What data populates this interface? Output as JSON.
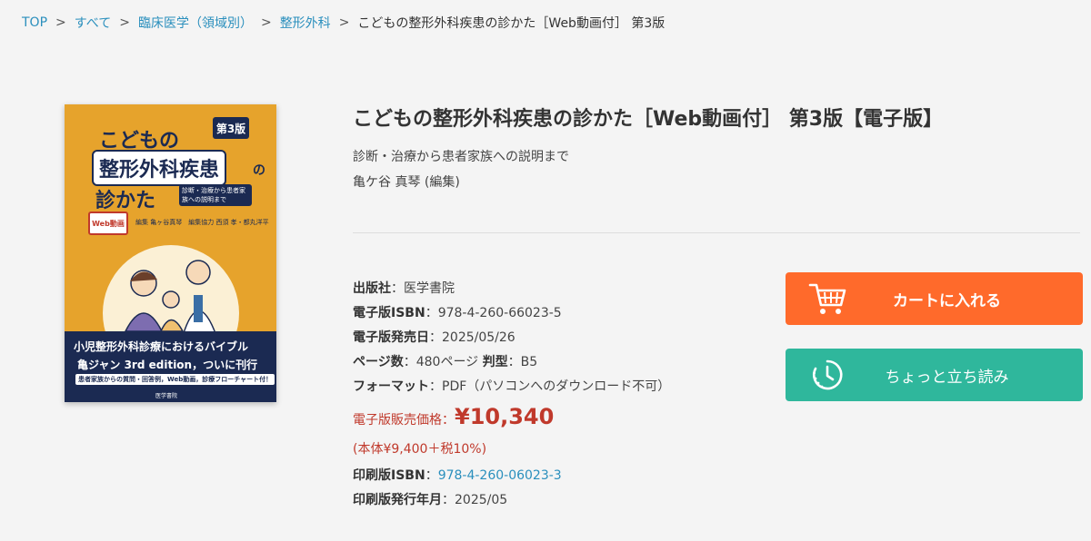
{
  "breadcrumb": {
    "items": [
      "TOP",
      "すべて",
      "臨床医学（領域別）",
      "整形外科"
    ],
    "current": "こどもの整形外科疾患の診かた［Web動画付］ 第3版",
    "separator": ">"
  },
  "cover": {
    "line1": "こどもの",
    "edition": "第3版",
    "line2": "整形外科疾患",
    "line2_suffix": "の",
    "line3": "診かた",
    "sub": "診断・治療から患者家族への説明まで",
    "web_badge": "Web動画",
    "editor": "編集 亀ヶ谷真琴　編集協力 西須 孝・都丸洋平",
    "band_line1": "小児整形外科診療におけるバイブル",
    "band_line2": "亀ジャン 3rd edition，ついに刊行",
    "band_line3": "患者家族からの質問・回答例，Web動画，診療フローチャート付！",
    "publisher_mark": "医学書院"
  },
  "product": {
    "title": "こどもの整形外科疾患の診かた［Web動画付］ 第3版【電子版】",
    "subtitle": "診断・治療から患者家族への説明まで",
    "author": "亀ケ谷 真琴 (編集)"
  },
  "details": {
    "publisher_label": "出版社",
    "publisher": "医学書院",
    "isbn_label": "電子版ISBN",
    "isbn": "978-4-260-66023-5",
    "release_label": "電子版発売日",
    "release": "2025/05/26",
    "pages_label": "ページ数",
    "pages": "480ページ",
    "size_label": "判型",
    "size": "B5",
    "format_label": "フォーマット",
    "format": "PDF（パソコンへのダウンロード不可）",
    "price_label": "電子版販売価格：",
    "price": "¥10,340",
    "price_note": "(本体¥9,400＋税10%)",
    "print_isbn_label": "印刷版ISBN",
    "print_isbn": "978-4-260-06023-3",
    "print_date_label": "印刷版発行年月",
    "print_date": "2025/05"
  },
  "buttons": {
    "cart": "カートに入れる",
    "preview": "ちょっと立ち読み"
  },
  "colors": {
    "link": "#2a8fbd",
    "cart": "#ff6a2b",
    "preview": "#2fb79c",
    "price": "#c0392b",
    "cover_bg": "#e6a32c",
    "cover_navy": "#1b2a52"
  },
  "icons": {
    "cart": "cart-icon",
    "preview": "clock-icon"
  }
}
